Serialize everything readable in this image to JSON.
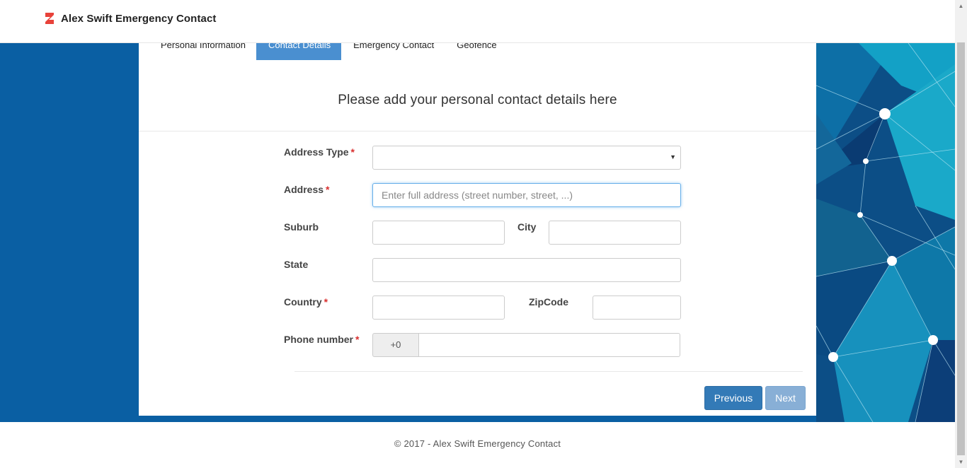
{
  "app": {
    "title": "Alex Swift Emergency Contact",
    "brand_color": "#e8423a"
  },
  "tabs": [
    {
      "label": "Personal Information",
      "active": false
    },
    {
      "label": "Contact Details",
      "active": true
    },
    {
      "label": "Emergency Contact",
      "active": false
    },
    {
      "label": "Geofence",
      "active": false
    }
  ],
  "form": {
    "heading": "Please add your personal contact details here",
    "required_marker": "*",
    "address_type": {
      "label": "Address Type",
      "required": true,
      "value": ""
    },
    "address": {
      "label": "Address",
      "required": true,
      "value": "",
      "placeholder": "Enter full address (street number, street, ...)"
    },
    "suburb": {
      "label": "Suburb",
      "value": ""
    },
    "city": {
      "label": "City",
      "value": ""
    },
    "state": {
      "label": "State",
      "value": ""
    },
    "country": {
      "label": "Country",
      "required": true,
      "value": ""
    },
    "zipcode": {
      "label": "ZipCode",
      "value": ""
    },
    "phone": {
      "label": "Phone number",
      "required": true,
      "prefix": "+0",
      "value": ""
    }
  },
  "buttons": {
    "previous": "Previous",
    "next": "Next"
  },
  "footer": {
    "text": "© 2017 - Alex Swift Emergency Contact"
  },
  "colors": {
    "hero_background": "#0a5fa3",
    "active_tab": "#4a8fd0",
    "primary_button": "#337ab7",
    "disabled_button": "#88afd6",
    "required": "#d9302f"
  },
  "icons": {
    "brand": "brand-logo-icon",
    "select_caret": "caret-down-icon"
  }
}
